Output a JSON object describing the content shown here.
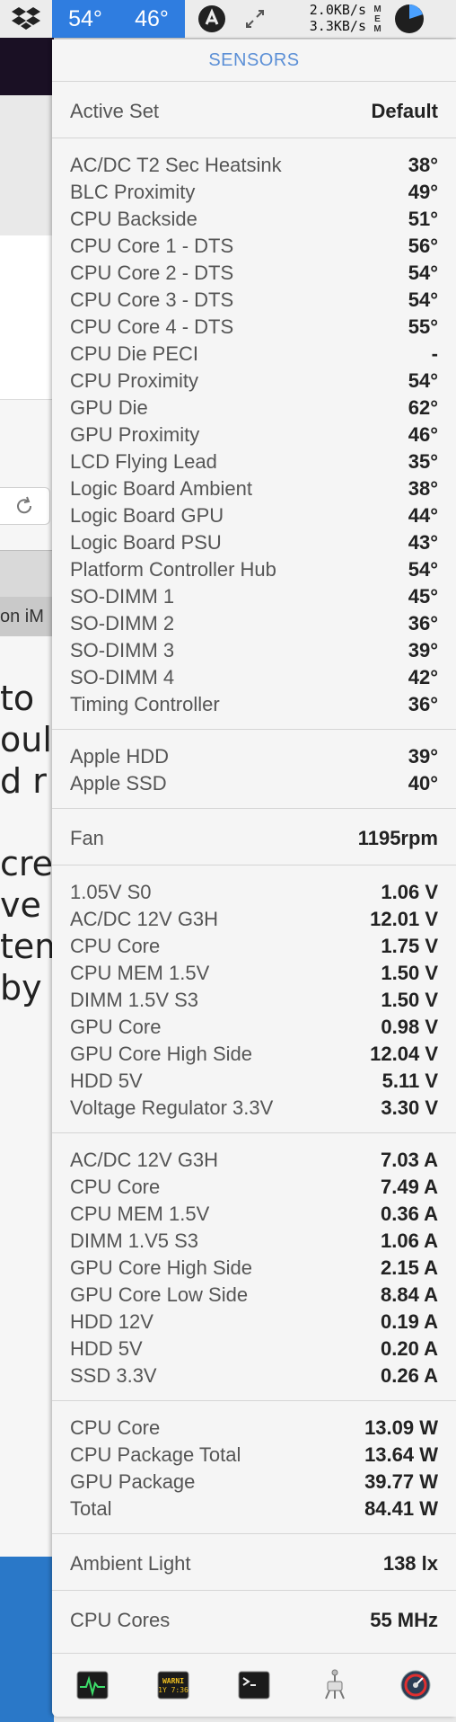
{
  "menubar": {
    "temp1": "54°",
    "temp2": "46°",
    "net_up": "2.0KB/s",
    "net_down": "3.3KB/s",
    "mem_label": "MEM",
    "icons": [
      "dropbox-icon",
      "avast-icon",
      "resize-arrows-icon",
      "memory-pie-icon"
    ]
  },
  "background_app": {
    "tab_text": "on iM",
    "text_lines": [
      " to",
      "oulc",
      "d r",
      "",
      "cree",
      "ve t",
      "tem",
      " by"
    ]
  },
  "panel": {
    "title": "SENSORS",
    "accent_color": "#5b8fd6",
    "active_set": {
      "label": "Active Set",
      "value": "Default"
    },
    "temperatures": [
      {
        "label": "AC/DC T2 Sec Heatsink",
        "value": "38°"
      },
      {
        "label": "BLC Proximity",
        "value": "49°"
      },
      {
        "label": "CPU Backside",
        "value": "51°"
      },
      {
        "label": "CPU Core 1 - DTS",
        "value": "56°"
      },
      {
        "label": "CPU Core 2 - DTS",
        "value": "54°"
      },
      {
        "label": "CPU Core 3 - DTS",
        "value": "54°"
      },
      {
        "label": "CPU Core 4 - DTS",
        "value": "55°"
      },
      {
        "label": "CPU Die PECI",
        "value": "-"
      },
      {
        "label": "CPU Proximity",
        "value": "54°"
      },
      {
        "label": "GPU Die",
        "value": "62°"
      },
      {
        "label": "GPU Proximity",
        "value": "46°"
      },
      {
        "label": "LCD Flying Lead",
        "value": "35°"
      },
      {
        "label": "Logic Board Ambient",
        "value": "38°"
      },
      {
        "label": "Logic Board GPU",
        "value": "44°"
      },
      {
        "label": "Logic Board PSU",
        "value": "43°"
      },
      {
        "label": "Platform Controller Hub",
        "value": "54°"
      },
      {
        "label": "SO-DIMM 1",
        "value": "45°"
      },
      {
        "label": "SO-DIMM 2",
        "value": "36°"
      },
      {
        "label": "SO-DIMM 3",
        "value": "39°"
      },
      {
        "label": "SO-DIMM 4",
        "value": "42°"
      },
      {
        "label": "Timing Controller",
        "value": "36°"
      }
    ],
    "drives": [
      {
        "label": "Apple HDD",
        "value": "39°"
      },
      {
        "label": "Apple SSD",
        "value": "40°"
      }
    ],
    "fan": {
      "label": "Fan",
      "value": "1195rpm"
    },
    "voltages": [
      {
        "label": "1.05V S0",
        "value": "1.06 V"
      },
      {
        "label": "AC/DC 12V G3H",
        "value": "12.01 V"
      },
      {
        "label": "CPU Core",
        "value": "1.75 V"
      },
      {
        "label": "CPU MEM 1.5V",
        "value": "1.50 V"
      },
      {
        "label": "DIMM 1.5V S3",
        "value": "1.50 V"
      },
      {
        "label": "GPU Core",
        "value": "0.98 V"
      },
      {
        "label": "GPU Core High Side",
        "value": "12.04 V"
      },
      {
        "label": "HDD 5V",
        "value": "5.11 V"
      },
      {
        "label": "Voltage Regulator 3.3V",
        "value": "3.30 V"
      }
    ],
    "currents": [
      {
        "label": "AC/DC 12V G3H",
        "value": "7.03 A"
      },
      {
        "label": "CPU Core",
        "value": "7.49 A"
      },
      {
        "label": "CPU MEM 1.5V",
        "value": "0.36 A"
      },
      {
        "label": "DIMM 1.V5 S3",
        "value": "1.06 A"
      },
      {
        "label": "GPU Core High Side",
        "value": "2.15 A"
      },
      {
        "label": "GPU Core Low Side",
        "value": "8.84 A"
      },
      {
        "label": "HDD 12V",
        "value": "0.19 A"
      },
      {
        "label": "HDD 5V",
        "value": "0.20 A"
      },
      {
        "label": "SSD 3.3V",
        "value": "0.26 A"
      }
    ],
    "power": [
      {
        "label": "CPU Core",
        "value": "13.09 W"
      },
      {
        "label": "CPU Package Total",
        "value": "13.64 W"
      },
      {
        "label": "GPU Package",
        "value": "39.77 W"
      },
      {
        "label": "Total",
        "value": "84.41 W"
      }
    ],
    "ambient": {
      "label": "Ambient Light",
      "value": "138 lx"
    },
    "cpu_cores": {
      "label": "CPU Cores",
      "value": "55 MHz"
    },
    "toolbar": {
      "icons": [
        "activity-monitor-icon",
        "console-icon",
        "terminal-icon",
        "system-information-icon",
        "disk-utility-icon"
      ],
      "console_text": "WARNI\n1Y 7:36"
    }
  }
}
